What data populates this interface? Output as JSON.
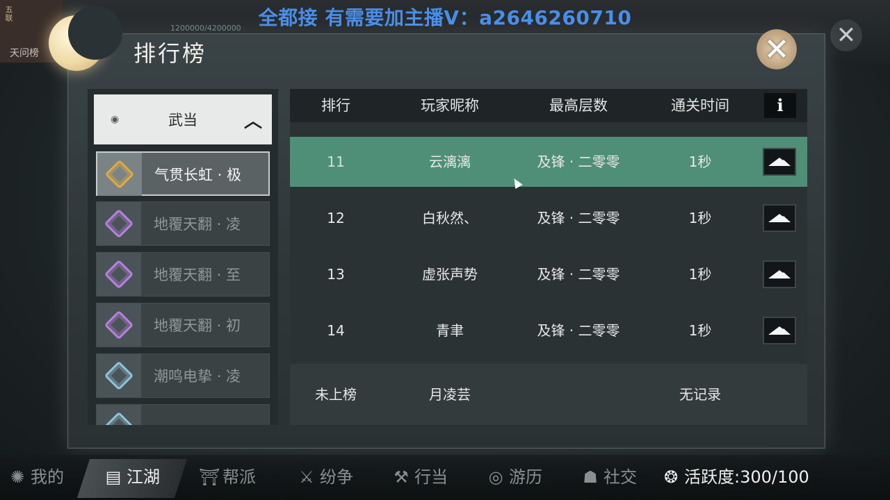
{
  "top": {
    "corner_tag": "五联",
    "corner_title": "天问榜",
    "hud_text": "1200000/4200000",
    "streamer_banner": "全都接 有需要加主播V：a2646260710",
    "screen_close": "✕"
  },
  "panel": {
    "title": "排行榜",
    "close": "✕"
  },
  "left_list": {
    "section_label": "武当",
    "section_chevron": "^",
    "items": [
      {
        "label": "气贯长虹 · 极",
        "active": true
      },
      {
        "label": "地覆天翻 · 凌"
      },
      {
        "label": "地覆天翻 · 至"
      },
      {
        "label": "地覆天翻 · 初"
      },
      {
        "label": "潮鸣电挚 · 凌"
      }
    ]
  },
  "table": {
    "headers": [
      "排行",
      "玩家昵称",
      "最高层数",
      "通关时间"
    ],
    "info_label": "i",
    "rows": [
      {
        "rank": "11",
        "name": "云漓漓",
        "floor": "及锋 · 二零零",
        "time": "1秒"
      },
      {
        "rank": "12",
        "name": "白秋然、",
        "floor": "及锋 · 二零零",
        "time": "1秒"
      },
      {
        "rank": "13",
        "name": "虚张声势",
        "floor": "及锋 · 二零零",
        "time": "1秒"
      },
      {
        "rank": "14",
        "name": "青聿",
        "floor": "及锋 · 二零零",
        "time": "1秒"
      }
    ],
    "self": {
      "rank": "未上榜",
      "name": "月凌芸",
      "time": "无记录"
    }
  },
  "bottom_nav": [
    {
      "label": "我的",
      "icon": "gear-icon"
    },
    {
      "label": "江湖",
      "icon": "book-icon",
      "active": true
    },
    {
      "label": "帮派",
      "icon": "banner-icon"
    },
    {
      "label": "纷争",
      "icon": "swords-icon"
    },
    {
      "label": "行当",
      "icon": "tools-icon"
    },
    {
      "label": "游历",
      "icon": "compass-icon"
    },
    {
      "label": "社交",
      "icon": "people-icon"
    },
    {
      "label": "活跃度:300/100",
      "icon": "activity-icon"
    }
  ],
  "colors": {
    "accent_row": "#4f8f78",
    "banner_text": "#4a8de8",
    "selected_icon": "#e2a93e",
    "purple_icon": "#b880e2",
    "blue_icon": "#8fc4dc"
  }
}
